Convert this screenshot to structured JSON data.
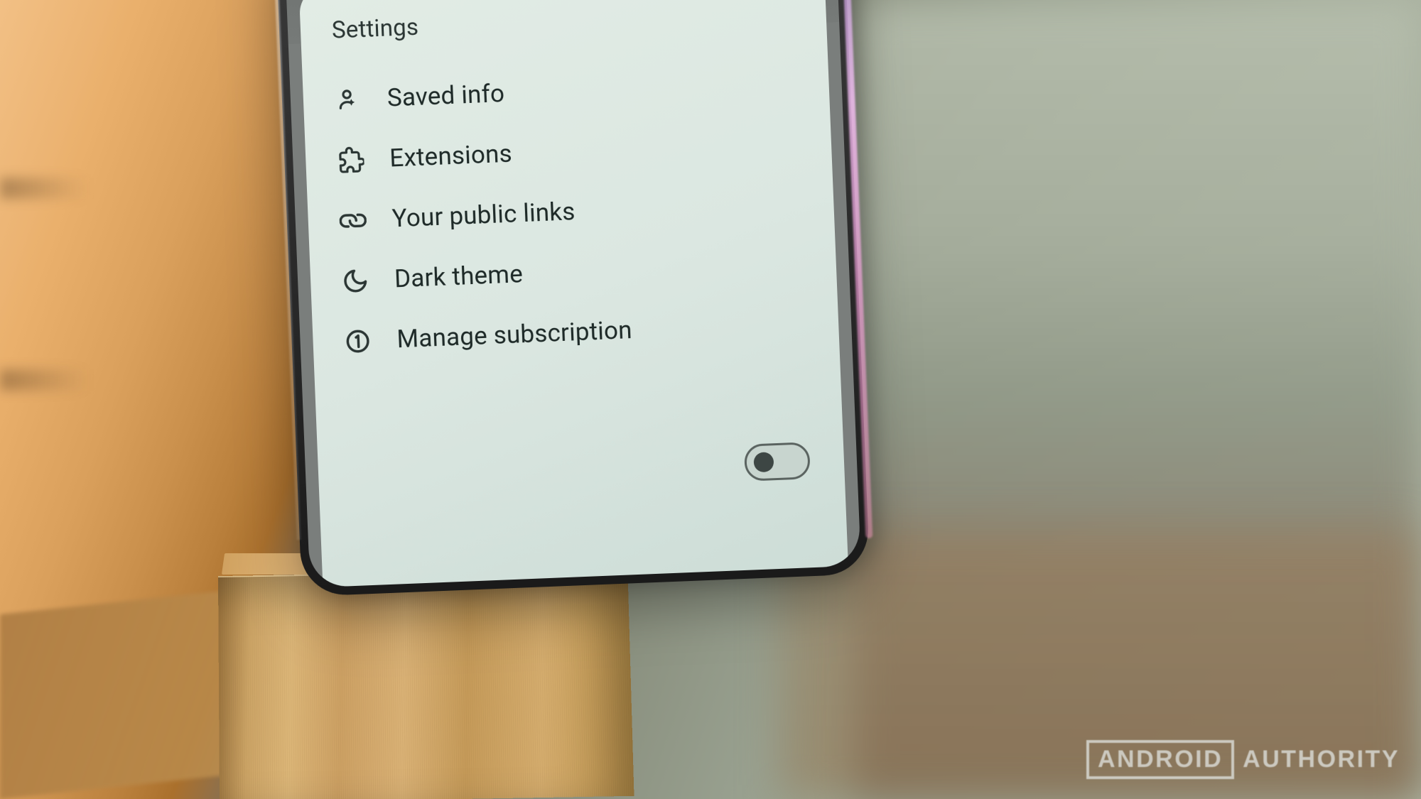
{
  "sheet": {
    "title": "Settings",
    "items": [
      {
        "icon": "person-sparkle-icon",
        "label": "Saved info"
      },
      {
        "icon": "extension-icon",
        "label": "Extensions"
      },
      {
        "icon": "link-icon",
        "label": "Your public links"
      },
      {
        "icon": "moon-icon",
        "label": "Dark theme"
      },
      {
        "icon": "circled-one-icon",
        "label": "Manage subscription"
      }
    ],
    "toggle_enabled": false
  },
  "watermark": {
    "brand_box": "ANDROID",
    "brand_text": "AUTHORITY"
  }
}
